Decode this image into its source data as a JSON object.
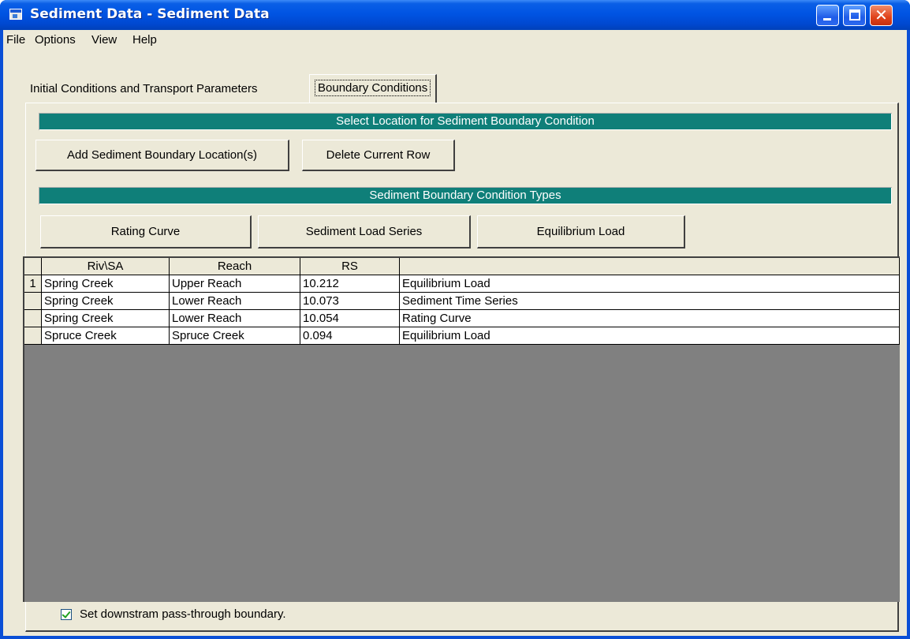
{
  "window": {
    "title": "Sediment Data - Sediment Data"
  },
  "menu": [
    "File",
    "Options",
    "View",
    "Help"
  ],
  "tabs": [
    {
      "label": "Initial Conditions and Transport Parameters",
      "active": false
    },
    {
      "label": "Boundary Conditions",
      "active": true
    }
  ],
  "location_section": {
    "header": "Select Location for Sediment Boundary Condition",
    "add_button": "Add Sediment Boundary Location(s)",
    "delete_button": "Delete Current Row"
  },
  "types_section": {
    "header": "Sediment Boundary Condition Types",
    "buttons": [
      "Rating Curve",
      "Sediment Load Series",
      "Equilibrium Load"
    ]
  },
  "grid": {
    "columns": [
      "Riv\\SA",
      "Reach",
      "RS",
      ""
    ],
    "rows": [
      {
        "index": "1",
        "river": "Spring Creek",
        "reach": "Upper Reach",
        "rs": "10.212",
        "type": "Equilibrium Load"
      },
      {
        "index": "",
        "river": "Spring Creek",
        "reach": "Lower Reach",
        "rs": "10.073",
        "type": "Sediment Time Series"
      },
      {
        "index": "",
        "river": "Spring Creek",
        "reach": "Lower Reach",
        "rs": "10.054",
        "type": "Rating Curve"
      },
      {
        "index": "",
        "river": "Spruce Creek",
        "reach": "Spruce Creek",
        "rs": "0.094",
        "type": "Equilibrium Load"
      }
    ]
  },
  "pass_through": {
    "label": "Set downstram pass-through boundary.",
    "checked": true
  },
  "colors": {
    "title_bar": "#0054e3",
    "section_bar": "#0f7f79",
    "face": "#ece9d8",
    "grid_bg": "#808080"
  }
}
